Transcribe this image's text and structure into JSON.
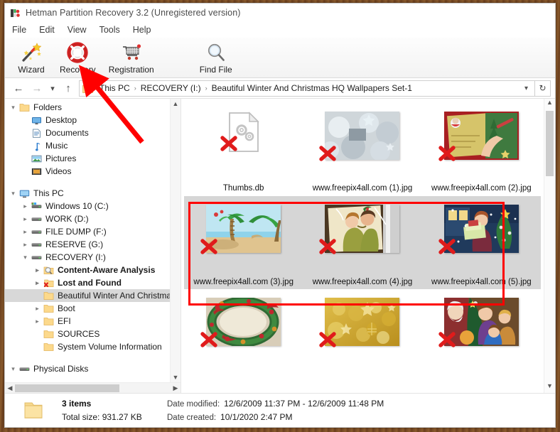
{
  "window": {
    "title": "Hetman Partition Recovery 3.2 (Unregistered version)",
    "app_icon": "hetman-app-icon"
  },
  "menubar": {
    "items": [
      {
        "label": "File",
        "name": "menu-file"
      },
      {
        "label": "Edit",
        "name": "menu-edit"
      },
      {
        "label": "View",
        "name": "menu-view"
      },
      {
        "label": "Tools",
        "name": "menu-tools"
      },
      {
        "label": "Help",
        "name": "menu-help"
      }
    ]
  },
  "toolbar": {
    "buttons": [
      {
        "label": "Wizard",
        "icon": "magic-wand-icon"
      },
      {
        "label": "Recovery",
        "icon": "life-ring-icon"
      },
      {
        "label": "Registration",
        "icon": "shopping-cart-icon"
      },
      {
        "label": "Find File",
        "icon": "magnifier-icon"
      }
    ]
  },
  "addressbar": {
    "back_icon": "back-arrow-icon",
    "forward_icon": "forward-arrow-icon",
    "history_icon": "chevron-down-icon",
    "up_icon": "up-arrow-icon",
    "folder_icon": "folder-icon",
    "crumbs": [
      "This PC",
      "RECOVERY (I:)",
      "Beautiful Winter And Christmas HQ Wallpapers Set-1"
    ],
    "separator": "›",
    "dropdown_icon": "chevron-down-icon",
    "refresh_icon": "refresh-icon"
  },
  "sidebar": {
    "items": [
      {
        "label": "Folders",
        "icon": "folder-icon",
        "indent": 0,
        "chevron": "expanded",
        "bold": false,
        "selected": false
      },
      {
        "label": "Desktop",
        "icon": "desktop-icon",
        "indent": 1,
        "chevron": "none",
        "bold": false,
        "selected": false
      },
      {
        "label": "Documents",
        "icon": "documents-icon",
        "indent": 1,
        "chevron": "none",
        "bold": false,
        "selected": false
      },
      {
        "label": "Music",
        "icon": "music-icon",
        "indent": 1,
        "chevron": "none",
        "bold": false,
        "selected": false
      },
      {
        "label": "Pictures",
        "icon": "pictures-icon",
        "indent": 1,
        "chevron": "none",
        "bold": false,
        "selected": false
      },
      {
        "label": "Videos",
        "icon": "videos-icon",
        "indent": 1,
        "chevron": "none",
        "bold": false,
        "selected": false
      },
      {
        "label": "",
        "icon": "spacer",
        "indent": 0,
        "chevron": "none",
        "bold": false,
        "selected": false
      },
      {
        "label": "This PC",
        "icon": "this-pc-icon",
        "indent": 0,
        "chevron": "expanded",
        "bold": false,
        "selected": false
      },
      {
        "label": "Windows 10 (C:)",
        "icon": "system-drive-icon",
        "indent": 1,
        "chevron": "collapsed",
        "bold": false,
        "selected": false
      },
      {
        "label": "WORK (D:)",
        "icon": "drive-icon",
        "indent": 1,
        "chevron": "collapsed",
        "bold": false,
        "selected": false
      },
      {
        "label": "FILE DUMP (F:)",
        "icon": "drive-icon",
        "indent": 1,
        "chevron": "collapsed",
        "bold": false,
        "selected": false
      },
      {
        "label": "RESERVE (G:)",
        "icon": "drive-icon",
        "indent": 1,
        "chevron": "collapsed",
        "bold": false,
        "selected": false
      },
      {
        "label": "RECOVERY (I:)",
        "icon": "drive-icon",
        "indent": 1,
        "chevron": "expanded",
        "bold": false,
        "selected": false
      },
      {
        "label": "Content-Aware Analysis",
        "icon": "magnifier-folder-icon",
        "indent": 2,
        "chevron": "collapsed",
        "bold": true,
        "selected": false
      },
      {
        "label": "Lost and Found",
        "icon": "deleted-folder-icon",
        "indent": 2,
        "chevron": "collapsed",
        "bold": true,
        "selected": false
      },
      {
        "label": "Beautiful Winter And Christmas",
        "icon": "folder-icon",
        "indent": 2,
        "chevron": "none",
        "bold": false,
        "selected": true
      },
      {
        "label": "Boot",
        "icon": "folder-icon",
        "indent": 2,
        "chevron": "collapsed",
        "bold": false,
        "selected": false
      },
      {
        "label": "EFI",
        "icon": "folder-icon",
        "indent": 2,
        "chevron": "collapsed",
        "bold": false,
        "selected": false
      },
      {
        "label": "SOURCES",
        "icon": "folder-icon",
        "indent": 2,
        "chevron": "none",
        "bold": false,
        "selected": false
      },
      {
        "label": "System Volume Information",
        "icon": "folder-icon",
        "indent": 2,
        "chevron": "none",
        "bold": false,
        "selected": false
      },
      {
        "label": "",
        "icon": "spacer",
        "indent": 0,
        "chevron": "none",
        "bold": false,
        "selected": false
      },
      {
        "label": "Physical Disks",
        "icon": "drive-icon",
        "indent": 0,
        "chevron": "expanded",
        "bold": false,
        "selected": false
      }
    ],
    "scroll_up_icon": "chevron-up-icon",
    "scroll_down_icon": "chevron-down-icon",
    "scroll_left_icon": "chevron-left-icon",
    "scroll_right_icon": "chevron-right-icon"
  },
  "files": [
    {
      "name": "Thumbs.db",
      "kind": "document",
      "selected": false,
      "deleted": true,
      "label_visible": true
    },
    {
      "name": "www.freepix4all.com (1).jpg",
      "kind": "image",
      "selected": false,
      "deleted": true,
      "label_visible": true,
      "thumb": "silver-baubles"
    },
    {
      "name": "www.freepix4all.com (2).jpg",
      "kind": "image",
      "selected": false,
      "deleted": true,
      "label_visible": true,
      "thumb": "hand-writing-card"
    },
    {
      "name": "www.freepix4all.com (3).jpg",
      "kind": "image",
      "selected": true,
      "deleted": true,
      "label_visible": true,
      "thumb": "palm-beach"
    },
    {
      "name": "www.freepix4all.com (4).jpg",
      "kind": "image",
      "selected": true,
      "deleted": true,
      "label_visible": true,
      "thumb": "couple-embrace"
    },
    {
      "name": "www.freepix4all.com (5).jpg",
      "kind": "image",
      "selected": true,
      "deleted": true,
      "label_visible": true,
      "thumb": "woman-gifts-tree"
    },
    {
      "name": "",
      "kind": "image",
      "selected": false,
      "deleted": true,
      "label_visible": false,
      "thumb": "holly-wreath"
    },
    {
      "name": "",
      "kind": "image",
      "selected": false,
      "deleted": true,
      "label_visible": false,
      "thumb": "gold-ornaments"
    },
    {
      "name": "",
      "kind": "image",
      "selected": false,
      "deleted": true,
      "label_visible": false,
      "thumb": "family-santa"
    }
  ],
  "grid_scroll": {
    "up_icon": "chevron-up-icon",
    "down_icon": "chevron-down-icon"
  },
  "statusbar": {
    "folder_icon": "folder-icon",
    "items_count": "3 items",
    "total_size": "Total size: 931.27 KB",
    "date_modified_label": "Date modified:",
    "date_modified_value": "12/6/2009 11:37 PM - 12/6/2009 11:48 PM",
    "date_created_label": "Date created:",
    "date_created_value": "10/1/2020 2:47 PM"
  },
  "annotations": {
    "arrow_color": "#ff0000",
    "box_color": "#ff0000",
    "arrow_points_to": "Recovery",
    "box_surrounds": "three selected jpg files"
  }
}
